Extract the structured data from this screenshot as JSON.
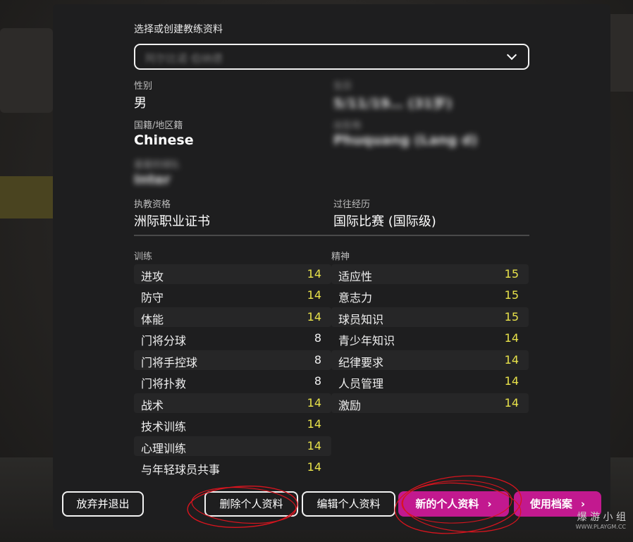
{
  "header": {
    "select_title": "选择或创建教练资料",
    "selected_profile": "阿尔比诺·伯纳德"
  },
  "profile": {
    "gender_label": "性别",
    "gender_value": "男",
    "birth_label": "生日",
    "birth_value": "5/11/19… (31岁)",
    "nationality_label": "国籍/地区籍",
    "nationality_value": "Chinese",
    "birthplace_label": "出生地",
    "birthplace_value": "Phuquang (Lang d)",
    "team_label": "喜爱的球队",
    "team_value": "Inter",
    "license_label": "执教资格",
    "license_value": "洲际职业证书",
    "experience_label": "过往经历",
    "experience_value": "国际比赛 (国际级)"
  },
  "training": {
    "title": "训练",
    "items": [
      {
        "name": "进攻",
        "value": "14"
      },
      {
        "name": "防守",
        "value": "14"
      },
      {
        "name": "体能",
        "value": "14"
      },
      {
        "name": "门将分球",
        "value": "8"
      },
      {
        "name": "门将手控球",
        "value": "8"
      },
      {
        "name": "门将扑救",
        "value": "8"
      },
      {
        "name": "战术",
        "value": "14"
      },
      {
        "name": "技术训练",
        "value": "14"
      },
      {
        "name": "心理训练",
        "value": "14"
      },
      {
        "name": "与年轻球员共事",
        "value": "14"
      }
    ]
  },
  "mental": {
    "title": "精神",
    "items": [
      {
        "name": "适应性",
        "value": "15"
      },
      {
        "name": "意志力",
        "value": "15"
      },
      {
        "name": "球员知识",
        "value": "15"
      },
      {
        "name": "青少年知识",
        "value": "14"
      },
      {
        "name": "纪律要求",
        "value": "14"
      },
      {
        "name": "人员管理",
        "value": "14"
      },
      {
        "name": "激励",
        "value": "14"
      }
    ]
  },
  "buttons": {
    "quit": "放弃并退出",
    "delete": "删除个人资料",
    "edit": "编辑个人资料",
    "new": "新的个人资料",
    "use": "使用档案"
  },
  "watermark": {
    "main": "爆 游 小 组",
    "sub": "WWW.PLAYGM.CC"
  },
  "colors": {
    "accent_pink": "#c2198f",
    "value_yellow": "#e8e24a",
    "panel": "#1e1e1f"
  }
}
